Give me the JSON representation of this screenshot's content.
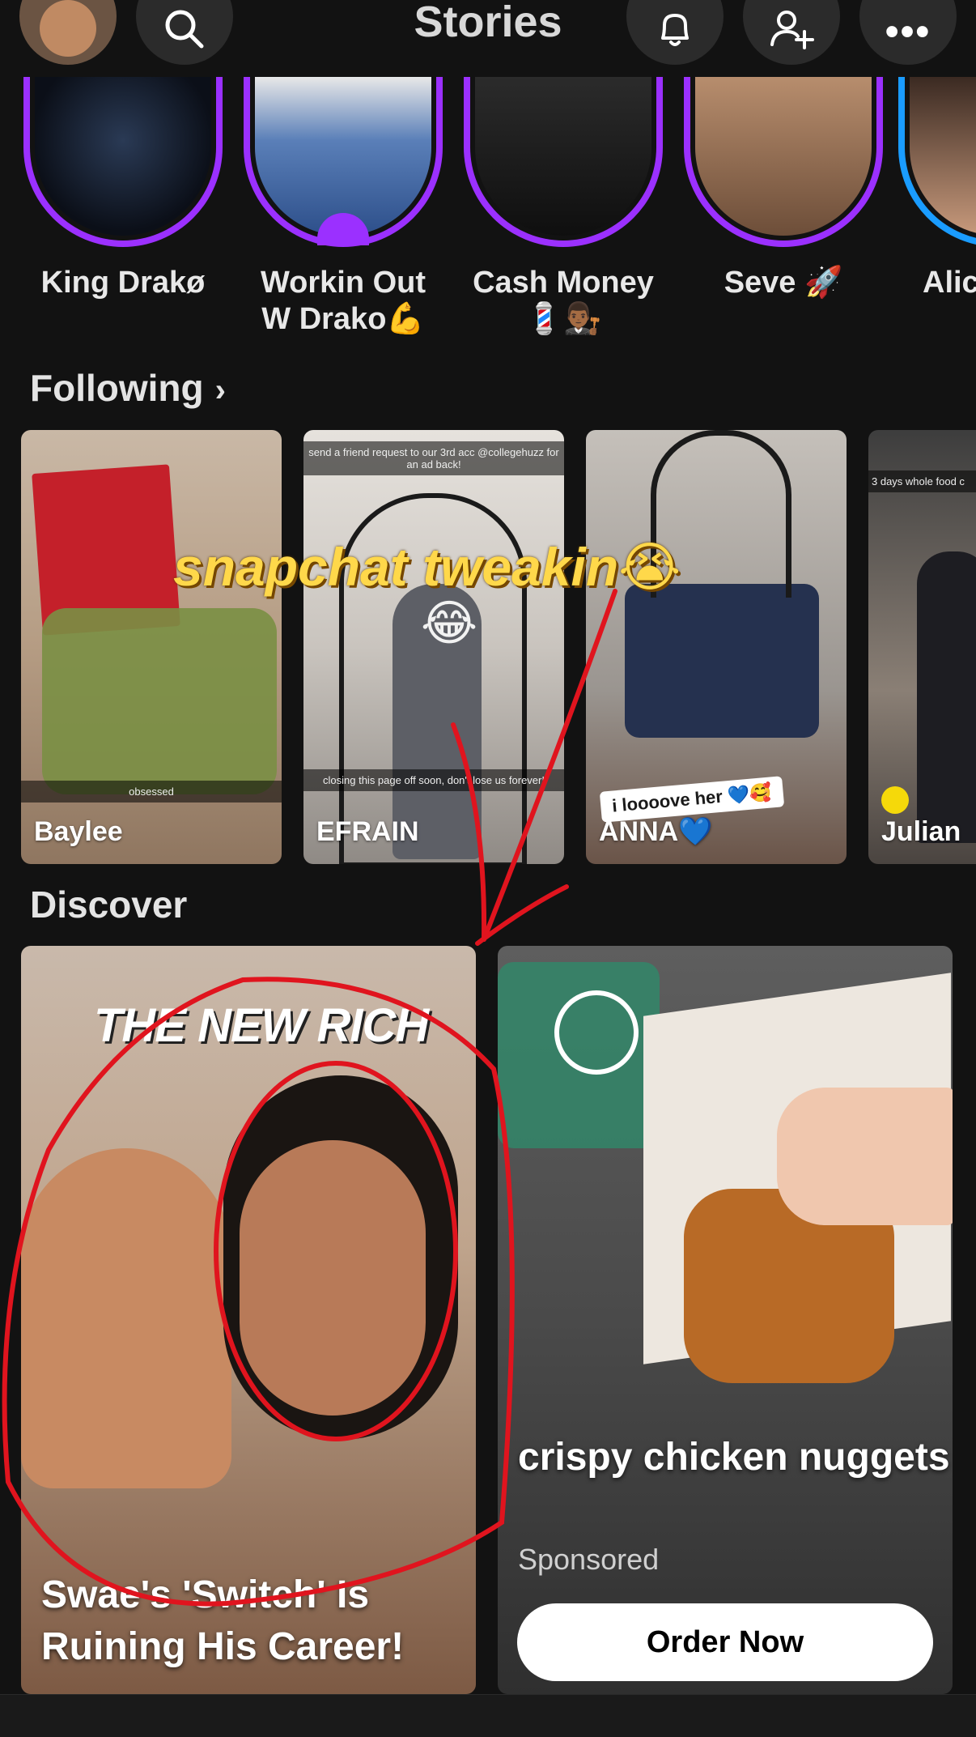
{
  "header": {
    "title": "Stories",
    "icons": [
      "avatar",
      "search-icon",
      "bell-icon",
      "add-friend-icon",
      "more-icon"
    ]
  },
  "stories": [
    {
      "name": "King Drakø",
      "ring": "purple"
    },
    {
      "name": "Workin Out W Drako💪",
      "ring": "purple",
      "group": true
    },
    {
      "name": "Cash Money 💈👨🏾‍⚖️",
      "ring": "purple"
    },
    {
      "name": "Seve 🚀",
      "ring": "purple"
    },
    {
      "name": "Alic",
      "ring": "blue"
    }
  ],
  "following": {
    "title": "Following",
    "cards": [
      {
        "name": "Baylee",
        "caption": "obsessed"
      },
      {
        "name": "EFRAIN",
        "caption_top": "send a friend request to our 3rd acc @collegehuzz for an ad back!",
        "caption_bottom": "closing this page off soon, don't lose us forever!"
      },
      {
        "name": "ANNA💙",
        "sticker": "i loooove her 💙🥰"
      },
      {
        "name": "Julian",
        "caption_top": "3 days whole food c"
      }
    ]
  },
  "overlay": {
    "text": "snapchat tweakin😭",
    "emoji": "😂"
  },
  "discover": {
    "title": "Discover",
    "cards": [
      {
        "brand": "THE NEW RICH",
        "headline": "Swae's 'Switch' Is Ruining His Career!"
      },
      {
        "headline": "crispy chicken nuggets",
        "sponsored": "Sponsored",
        "cta": "Order Now"
      }
    ]
  },
  "colors": {
    "background": "#121212",
    "story_ring": "#9b30ff",
    "story_ring_alt": "#1a9cff",
    "annotation_red": "#e0141e",
    "overlay_yellow": "#ffd84a"
  }
}
